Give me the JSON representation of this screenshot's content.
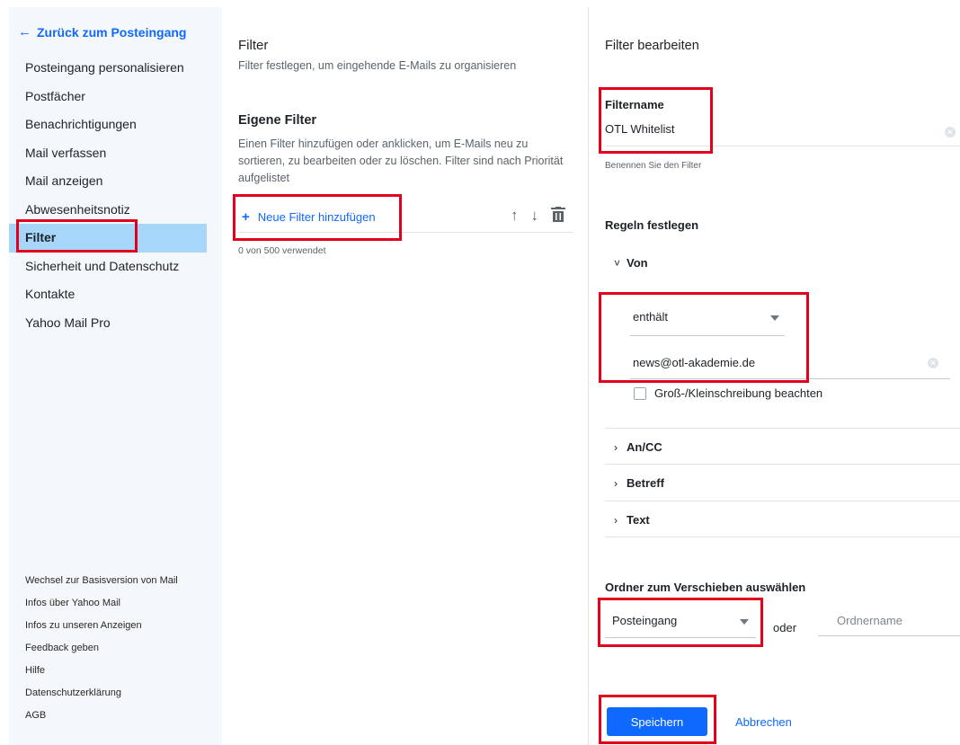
{
  "sidebar": {
    "back_label": "Zurück zum Posteingang",
    "items": [
      {
        "label": "Posteingang personalisieren"
      },
      {
        "label": "Postfächer"
      },
      {
        "label": "Benachrichtigungen"
      },
      {
        "label": "Mail verfassen"
      },
      {
        "label": "Mail anzeigen"
      },
      {
        "label": "Abwesenheitsnotiz"
      },
      {
        "label": "Filter"
      },
      {
        "label": "Sicherheit und Datenschutz"
      },
      {
        "label": "Kontakte"
      },
      {
        "label": "Yahoo Mail Pro"
      }
    ],
    "footer": [
      {
        "label": "Wechsel zur Basisversion von Mail"
      },
      {
        "label": "Infos über Yahoo Mail"
      },
      {
        "label": "Infos zu unseren Anzeigen"
      },
      {
        "label": "Feedback geben"
      },
      {
        "label": "Hilfe"
      },
      {
        "label": "Datenschutzerklärung"
      },
      {
        "label": "AGB"
      }
    ]
  },
  "filters": {
    "title": "Filter",
    "subtitle": "Filter festlegen, um eingehende E-Mails zu organisieren",
    "own_title": "Eigene Filter",
    "own_description": "Einen Filter hinzufügen oder anklicken, um E-Mails neu zu sortieren, zu bearbeiten oder zu löschen. Filter sind nach Priorität aufgelistet",
    "add_label": "Neue Filter hinzufügen",
    "usage": "0 von 500 verwendet"
  },
  "edit": {
    "title": "Filter bearbeiten",
    "name_label": "Filtername",
    "name_value": "OTL Whitelist",
    "name_hint": "Benennen Sie den Filter",
    "rules_title": "Regeln festlegen",
    "from_label": "Von",
    "condition": "enthält",
    "value": "news@otl-akademie.de",
    "case_label": "Groß-/Kleinschreibung beachten",
    "sections": [
      {
        "label": "An/CC"
      },
      {
        "label": "Betreff"
      },
      {
        "label": "Text"
      }
    ],
    "folder_title": "Ordner zum Verschieben auswählen",
    "folder_value": "Posteingang",
    "or_label": "oder",
    "folder_name_placeholder": "Ordnername",
    "save_label": "Speichern",
    "cancel_label": "Abbrechen"
  },
  "colors": {
    "accent": "#0f69ff",
    "active_nav": "#a6d6f9",
    "highlight": "#e2001a"
  }
}
